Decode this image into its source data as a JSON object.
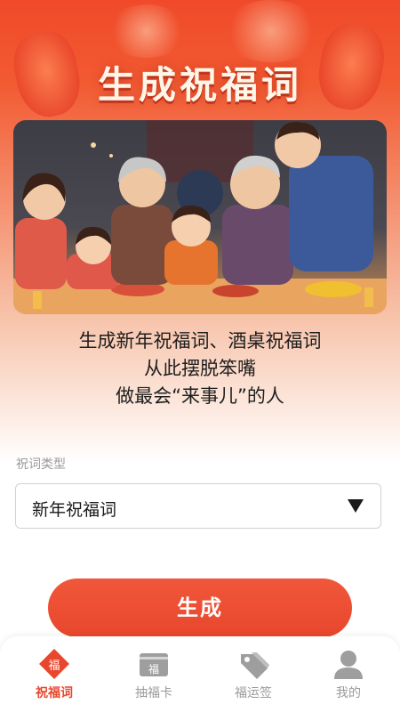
{
  "header": {
    "title": "生成祝福词"
  },
  "illustration": {
    "caption": "family-new-year-dinner-illustration"
  },
  "slogan": {
    "lines": [
      "生成新年祝福词、酒桌祝福词",
      "从此摆脱笨嘴",
      "做最会“来事儿”的人"
    ]
  },
  "form": {
    "type_label": "祝词类型",
    "type_value": "新年祝福词"
  },
  "actions": {
    "generate_label": "生成"
  },
  "tabbar": {
    "items": [
      {
        "label": "祝福词",
        "icon": "fu-diamond-icon",
        "active": true
      },
      {
        "label": "抽福卡",
        "icon": "fu-card-icon",
        "active": false
      },
      {
        "label": "福运签",
        "icon": "tag-icon",
        "active": false
      },
      {
        "label": "我的",
        "icon": "user-icon",
        "active": false
      }
    ]
  },
  "colors": {
    "primary": "#e8472d",
    "inactive": "#9a9a9a",
    "header": "#f04a2a"
  }
}
